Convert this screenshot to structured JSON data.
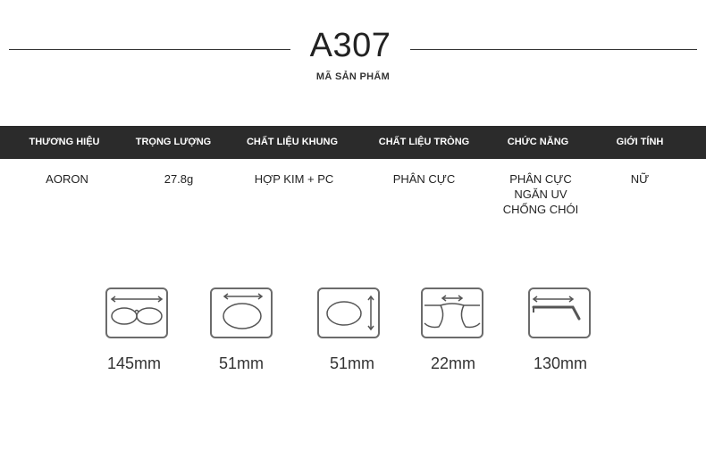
{
  "product": {
    "code": "A307",
    "code_label": "MÃ SẢN PHẨM"
  },
  "specs": {
    "headers": [
      "THƯƠNG HIỆU",
      "TRỌNG LƯỢNG",
      "CHẤT LIỆU KHUNG",
      "CHẤT LIỆU TRÒNG",
      "CHỨC NĂNG",
      "GIỚI TÍNH"
    ],
    "values": {
      "brand": "AORON",
      "weight": "27.8g",
      "frame_material": "HỢP KIM + PC",
      "lens_material": "PHÂN CỰC",
      "function": [
        "PHÂN CỰC",
        "NGĂN UV",
        "CHỐNG CHÓI"
      ],
      "gender": "NỮ"
    }
  },
  "dimensions": [
    {
      "icon": "total-width-icon",
      "value": "145mm"
    },
    {
      "icon": "lens-width-icon",
      "value": "51mm"
    },
    {
      "icon": "lens-height-icon",
      "value": "51mm"
    },
    {
      "icon": "bridge-width-icon",
      "value": "22mm"
    },
    {
      "icon": "temple-length-icon",
      "value": "130mm"
    }
  ],
  "colors": {
    "header_bg": "#2b2b2b",
    "text": "#222222",
    "icon": "#6b6b6b"
  }
}
